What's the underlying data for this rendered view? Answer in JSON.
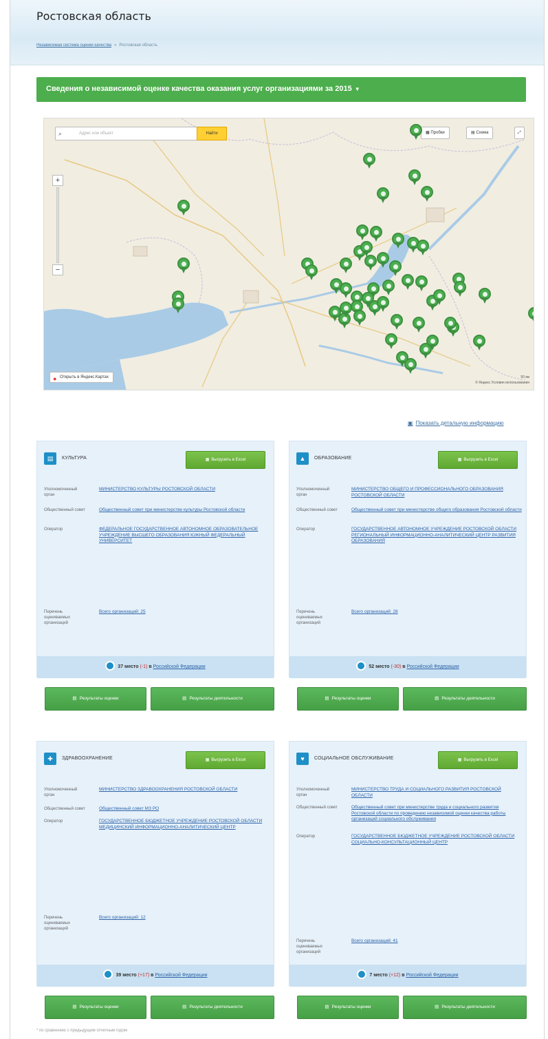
{
  "page": {
    "title": "Ростовская область",
    "breadcrumb": [
      "Независимая система оценки качества",
      "Ростовская область"
    ],
    "banner": {
      "text": "Сведения о независимой оценке качества оказания услуг организациями за",
      "year": "2015"
    }
  },
  "map": {
    "search_placeholder": "Адрес или объект",
    "search_button": "Найти",
    "traffic_button": "Пробки",
    "layers_button": "Схема",
    "open_yandex": "Открыть в Яндекс.Картах",
    "copyright": "© Яндекс Условия использования",
    "scale_label": "50 км"
  },
  "detail_link": "Показать детальную информацию",
  "cards": [
    {
      "title": "КУЛЬТУРА",
      "excel": "Выгрузить в Excel",
      "organ_label": "Уполномоченный орган",
      "organ_value": "МИНИСТЕРСТВО КУЛЬТУРЫ РОСТОВСКОЙ ОБЛАСТИ",
      "council_label": "Общественный совет",
      "council_value": "Общественный совет при министерстве культуры Ростовской области",
      "operator_label": "Оператор",
      "operator_value": "ФЕДЕРАЛЬНОЕ ГОСУДАРСТВЕННОЕ АВТОНОМНОЕ ОБРАЗОВАТЕЛЬНОЕ УЧРЕЖДЕНИЕ ВЫСШЕГО ОБРАЗОВАНИЯ ЮЖНЫЙ ФЕДЕРАЛЬНЫЙ УНИВЕРСИТЕТ",
      "orgs_label": "Перечень оцениваемых организаций",
      "orgs_value": "Всего организаций: 25",
      "rank_place": "37 место",
      "rank_delta": "(-1)",
      "rank_in": "в",
      "rank_link": "Российской Федерации",
      "btn_results": "Результаты оценки",
      "btn_improve": "Результаты деятельности"
    },
    {
      "title": "ОБРАЗОВАНИЕ",
      "excel": "Выгрузить в Excel",
      "organ_label": "Уполномоченный орган",
      "organ_value": "МИНИСТЕРСТВО ОБЩЕГО И ПРОФЕССИОНАЛЬНОГО ОБРАЗОВАНИЯ РОСТОВСКОЙ ОБЛАСТИ",
      "council_label": "Общественный совет",
      "council_value": "Общественный совет при министерстве общего образования Ростовской области",
      "operator_label": "Оператор",
      "operator_value": "ГОСУДАРСТВЕННОЕ АВТОНОМНОЕ УЧРЕЖДЕНИЕ РОСТОВСКОЙ ОБЛАСТИ РЕГИОНАЛЬНЫЙ ИНФОРМАЦИОННО-АНАЛИТИЧЕСКИЙ ЦЕНТР РАЗВИТИЯ ОБРАЗОВАНИЯ",
      "orgs_label": "Перечень оцениваемых организаций",
      "orgs_value": "Всего организаций: 28",
      "rank_place": "52 место",
      "rank_delta": "(-30)",
      "rank_in": "в",
      "rank_link": "Российской Федерации",
      "btn_results": "Результаты оценки",
      "btn_improve": "Результаты деятельности"
    },
    {
      "title": "ЗДРАВООХРАНЕНИЕ",
      "excel": "Выгрузить в Excel",
      "organ_label": "Уполномоченный орган",
      "organ_value": "МИНИСТЕРСТВО ЗДРАВООХРАНЕНИЯ РОСТОВСКОЙ ОБЛАСТИ",
      "council_label": "Общественный совет",
      "council_value": "Общественный совет МЗ РО",
      "operator_label": "Оператор",
      "operator_value": "ГОСУДАРСТВЕННОЕ БЮДЖЕТНОЕ УЧРЕЖДЕНИЕ РОСТОВСКОЙ ОБЛАСТИ МЕДИЦИНСКИЙ ИНФОРМАЦИОННО-АНАЛИТИЧЕСКИЙ ЦЕНТР",
      "orgs_label": "Перечень оцениваемых организаций",
      "orgs_value": "Всего организаций: 12",
      "rank_place": "39 место",
      "rank_delta": "(+17)",
      "rank_in": "в",
      "rank_link": "Российской Федерации",
      "btn_results": "Результаты оценки",
      "btn_improve": "Результаты деятельности"
    },
    {
      "title": "СОЦИАЛЬНОЕ ОБСЛУЖИВАНИЕ",
      "excel": "Выгрузить в Excel",
      "organ_label": "Уполномоченный орган",
      "organ_value": "МИНИСТЕРСТВО ТРУДА И СОЦИАЛЬНОГО РАЗВИТИЯ РОСТОВСКОЙ ОБЛАСТИ",
      "council_label": "Общественный совет",
      "council_value": "Общественный совет при министерстве труда и социального развития Ростовской области по проведению независимой оценки качества работы организаций социального обслуживания",
      "operator_label": "Оператор",
      "operator_value": "ГОСУДАРСТВЕННОЕ БЮДЖЕТНОЕ УЧРЕЖДЕНИЕ РОСТОВСКОЙ ОБЛАСТИ СОЦИАЛЬНО-КОНСУЛЬТАЦИОННЫЙ ЦЕНТР",
      "orgs_label": "Перечень оцениваемых организаций",
      "orgs_value": "Всего организаций: 41",
      "rank_place": "7 место",
      "rank_delta": "(+12)",
      "rank_in": "в",
      "rank_link": "Российской Федерации",
      "btn_results": "Результаты оценки",
      "btn_improve": "Результаты деятельности"
    }
  ],
  "footnote": "* по сравнению с предыдущим отчетным годом",
  "colors": {
    "banner": "#4cae4c",
    "card_bg": "#e6f1fa",
    "link": "#2d63a8",
    "accent_blue": "#1f8fc7",
    "marker": "#4caf50"
  },
  "icons": {
    "card_0": "culture-icon",
    "card_1": "education-icon",
    "card_2": "health-icon",
    "card_3": "social-icon"
  }
}
